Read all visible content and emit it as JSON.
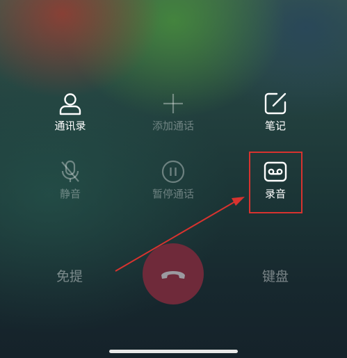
{
  "controls": {
    "contacts": {
      "label": "通讯录",
      "icon": "contacts-icon"
    },
    "add_call": {
      "label": "添加通话",
      "icon": "plus-icon"
    },
    "notes": {
      "label": "笔记",
      "icon": "note-edit-icon"
    },
    "mute": {
      "label": "静音",
      "icon": "mic-off-icon"
    },
    "hold": {
      "label": "暂停通话",
      "icon": "pause-icon"
    },
    "record": {
      "label": "录音",
      "icon": "record-tape-icon"
    }
  },
  "bottom": {
    "speaker_label": "免提",
    "keypad_label": "键盘",
    "hangup_icon": "phone-hangup-icon"
  },
  "colors": {
    "highlight": "#d8332f",
    "hangup_bg": "#6f2a3a"
  }
}
